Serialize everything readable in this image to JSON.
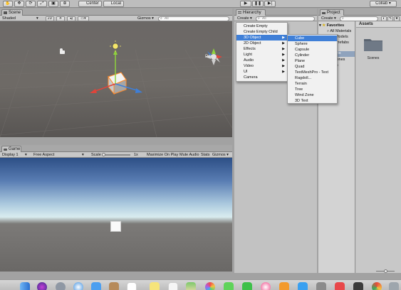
{
  "toolbar": {
    "pivot_label": "Center",
    "space_label": "Local",
    "collab_label": "Collab"
  },
  "scene": {
    "tab_label": "Scene",
    "shading_mode": "Shaded",
    "mode_2d": "2D",
    "gizmos_label": "Gizmos",
    "search_placeholder": "All",
    "persp_label": "Persp"
  },
  "game": {
    "tab_label": "Game",
    "display": "Display 1",
    "aspect": "Free Aspect",
    "scale_label": "Scale",
    "scale_value": "1x",
    "maximize_label": "Maximize On Play",
    "mute_label": "Mute Audio",
    "stats_label": "Stats",
    "gizmos_label": "Gizmos"
  },
  "hierarchy": {
    "tab_label": "Hierarchy",
    "create_label": "Create",
    "search_placeholder": "All"
  },
  "project": {
    "tab_label": "Project",
    "create_label": "Create",
    "favorites_label": "Favorites",
    "favorites": [
      "All Materials",
      "All Models",
      "All Prefabs"
    ],
    "assets_root": "Assets",
    "asset_children": [
      "Scenes"
    ],
    "asset_extra": "ages",
    "assets_header": "Assets",
    "folder_label": "Scenes",
    "assets_trunc": "ts",
    "scenes_trunc": "cenes"
  },
  "create_menu": {
    "items": [
      {
        "label": "Create Empty",
        "arrow": false,
        "selected": false
      },
      {
        "label": "Create Empty Child",
        "arrow": false,
        "selected": false
      },
      {
        "label": "3D Object",
        "arrow": true,
        "selected": true
      },
      {
        "label": "2D Object",
        "arrow": true,
        "selected": false
      },
      {
        "label": "Effects",
        "arrow": true,
        "selected": false
      },
      {
        "label": "Light",
        "arrow": true,
        "selected": false
      },
      {
        "label": "Audio",
        "arrow": true,
        "selected": false
      },
      {
        "label": "Video",
        "arrow": true,
        "selected": false
      },
      {
        "label": "UI",
        "arrow": true,
        "selected": false
      },
      {
        "label": "Camera",
        "arrow": false,
        "selected": false
      }
    ]
  },
  "object_menu": {
    "items": [
      {
        "label": "Cube",
        "selected": true
      },
      {
        "label": "Sphere",
        "selected": false
      },
      {
        "label": "Capsule",
        "selected": false
      },
      {
        "label": "Cylinder",
        "selected": false
      },
      {
        "label": "Plane",
        "selected": false
      },
      {
        "label": "Quad",
        "selected": false
      },
      {
        "label": "TextMeshPro - Text",
        "selected": false
      },
      {
        "label": "Ragdoll...",
        "selected": false
      },
      {
        "label": "Terrain",
        "selected": false
      },
      {
        "label": "Tree",
        "selected": false
      },
      {
        "label": "Wind Zone",
        "selected": false
      },
      {
        "label": "3D Text",
        "selected": false
      }
    ]
  },
  "colors": {
    "selection": "#3f7fd7",
    "panel": "#c2c2c2",
    "scene_bg": "#6b6866",
    "sky_top": "#2d4f86",
    "horizon": "#d9ecef"
  }
}
